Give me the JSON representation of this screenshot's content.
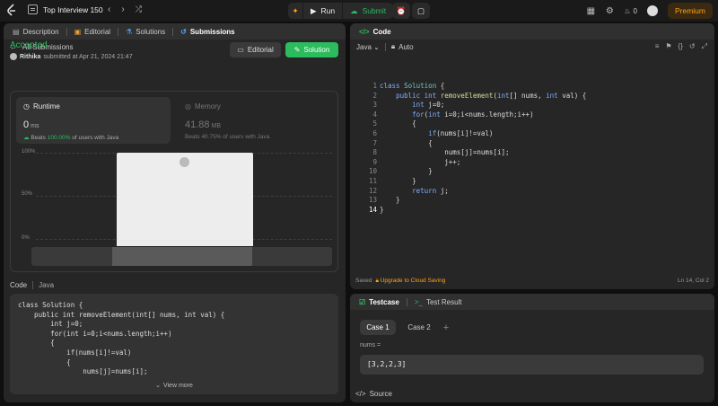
{
  "topbar": {
    "title": "Top Interview 150",
    "run": "Run",
    "submit": "Submit",
    "streak": "0",
    "premium": "Premium"
  },
  "left": {
    "tabs": [
      {
        "label": "Description"
      },
      {
        "label": "Editorial"
      },
      {
        "label": "Solutions"
      },
      {
        "label": "Submissions"
      }
    ],
    "back_label": "All Submissions",
    "status": "Accepted",
    "user": "Rithika",
    "submitted": "submitted at Apr 21, 2024 21:47",
    "editorial_btn": "Editorial",
    "solution_btn": "Solution",
    "runtime": {
      "label": "Runtime",
      "value": "0",
      "unit": "ms",
      "beats_word": "Beats",
      "beats_pct": "100.00%",
      "beats_tail": "of users with Java"
    },
    "memory": {
      "label": "Memory",
      "value": "41.88",
      "unit": "MB",
      "beats_word": "Beats",
      "beats_pct": "40.75%",
      "beats_tail": "of users with Java"
    },
    "chart_data": {
      "type": "bar",
      "y_ticks": [
        "100%",
        "50%",
        "0%"
      ],
      "ylim": [
        0,
        100
      ],
      "bars": [
        {
          "x": 0.0,
          "value": 100
        }
      ]
    },
    "code_label": "Code",
    "lang_label": "Java",
    "view_more": "View more",
    "code_preview": [
      "class Solution {",
      "    public int removeElement(int[] nums, int val) {",
      "        int j=0;",
      "        for(int i=0;i<nums.length;i++)",
      "        {",
      "            if(nums[i]!=val)",
      "            {",
      "                nums[j]=nums[i];"
    ]
  },
  "editor": {
    "tab": "Code",
    "language": "Java",
    "mode": "Auto",
    "line_numbers": [
      "1",
      "2",
      "3",
      "4",
      "5",
      "6",
      "7",
      "8",
      "9",
      "10",
      "11",
      "12",
      "13",
      "14"
    ],
    "status_saved": "Saved",
    "status_upgrade": "Upgrade to Cloud Saving",
    "cursor": "Ln 14, Col 2"
  },
  "testcase": {
    "tab1": "Testcase",
    "tab2": "Test Result",
    "case1": "Case 1",
    "case2": "Case 2",
    "input_label": "nums =",
    "input_value": "[3,2,2,3]",
    "source": "Source"
  }
}
